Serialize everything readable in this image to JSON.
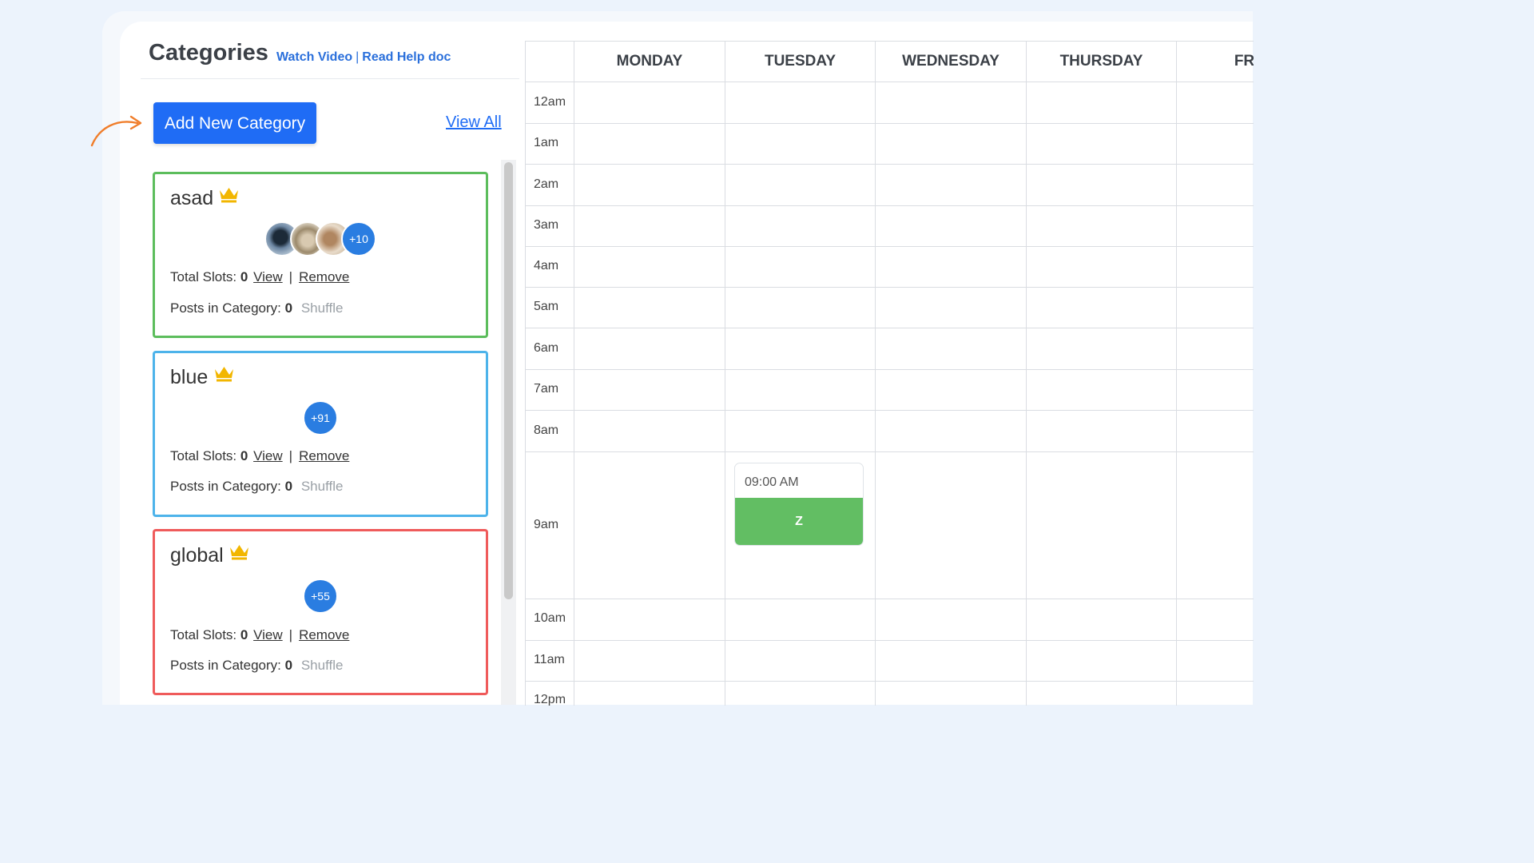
{
  "header": {
    "title": "Categories",
    "watch_video": "Watch Video",
    "separator": "|",
    "read_help": "Read Help doc"
  },
  "actions": {
    "add_new_category": "Add New Category",
    "view_all": "View All"
  },
  "categories": [
    {
      "name": "asad",
      "border_color": "#5cbd5c",
      "avatar_badge": "+10",
      "has_avatars": true,
      "total_slots_label": "Total Slots:",
      "total_slots": "0",
      "view": "View",
      "pipe": "|",
      "remove": "Remove",
      "posts_label": "Posts in Category:",
      "posts": "0",
      "shuffle": "Shuffle"
    },
    {
      "name": "blue",
      "border_color": "#4db3ea",
      "avatar_badge": "+91",
      "has_avatars": false,
      "total_slots_label": "Total Slots:",
      "total_slots": "0",
      "view": "View",
      "pipe": "|",
      "remove": "Remove",
      "posts_label": "Posts in Category:",
      "posts": "0",
      "shuffle": "Shuffle"
    },
    {
      "name": "global",
      "border_color": "#ef5b5b",
      "avatar_badge": "+55",
      "has_avatars": false,
      "total_slots_label": "Total Slots:",
      "total_slots": "0",
      "view": "View",
      "pipe": "|",
      "remove": "Remove",
      "posts_label": "Posts in Category:",
      "posts": "0",
      "shuffle": "Shuffle"
    }
  ],
  "calendar": {
    "days": [
      "MONDAY",
      "TUESDAY",
      "WEDNESDAY",
      "THURSDAY",
      "FRID"
    ],
    "times": [
      "12am",
      "1am",
      "2am",
      "3am",
      "4am",
      "5am",
      "6am",
      "7am",
      "8am",
      "9am",
      "10am",
      "11am",
      "12pm"
    ],
    "event": {
      "time": "09:00 AM",
      "label": "Z",
      "day": "TUESDAY",
      "color": "#62be63"
    }
  },
  "colors": {
    "primary": "#1f6cf5",
    "crown": "#f2b600",
    "badge": "#2a7de1"
  },
  "icons": {
    "crown": "crown-icon",
    "arrow": "curved-arrow-icon"
  }
}
